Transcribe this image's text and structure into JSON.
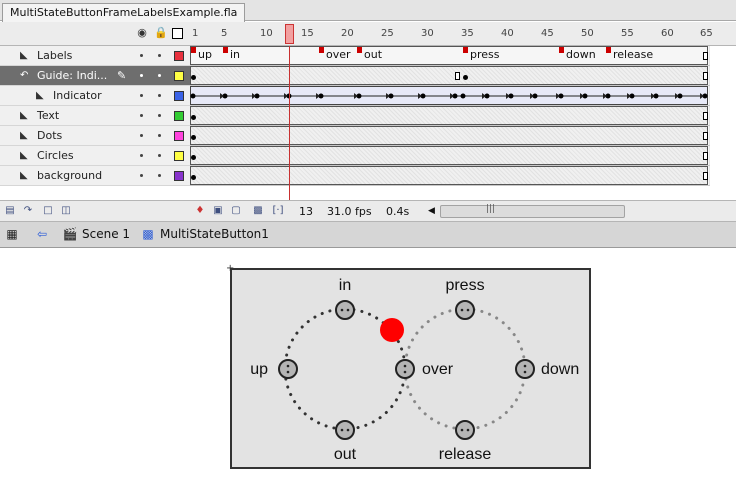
{
  "document_tab": "MultiStateButtonFrameLabelsExample.fla",
  "header_icons": {
    "eye": "eye-icon",
    "lock": "lock-icon",
    "outline": "outline-icon"
  },
  "ruler_numbers": [
    "1",
    "5",
    "10",
    "15",
    "20",
    "25",
    "30",
    "35",
    "40",
    "45",
    "50",
    "55",
    "60",
    "65"
  ],
  "layers": [
    {
      "name": "Labels",
      "color": "#e8313e",
      "type": "layer"
    },
    {
      "name": "Guide: Indi...",
      "color": "#ffff44",
      "type": "guide",
      "selected": true
    },
    {
      "name": "Indicator",
      "color": "#3b63e6",
      "type": "guided"
    },
    {
      "name": "Text",
      "color": "#33cc33",
      "type": "layer"
    },
    {
      "name": "Dots",
      "color": "#ff44dd",
      "type": "layer"
    },
    {
      "name": "Circles",
      "color": "#ffff44",
      "type": "layer"
    },
    {
      "name": "background",
      "color": "#8833cc",
      "type": "layer"
    }
  ],
  "frame_labels": [
    "up",
    "in",
    "over",
    "out",
    "press",
    "down",
    "release"
  ],
  "footer": {
    "current_frame": "13",
    "fps": "31.0 fps",
    "time": "0.4s"
  },
  "breadcrumb": {
    "scene": "Scene 1",
    "symbol": "MultiStateButton1"
  },
  "stage": {
    "labels": [
      "in",
      "press",
      "up",
      "over",
      "down",
      "out",
      "release"
    ],
    "indicator_color": "#ff0000",
    "node_fill": "#b5b5b5"
  }
}
